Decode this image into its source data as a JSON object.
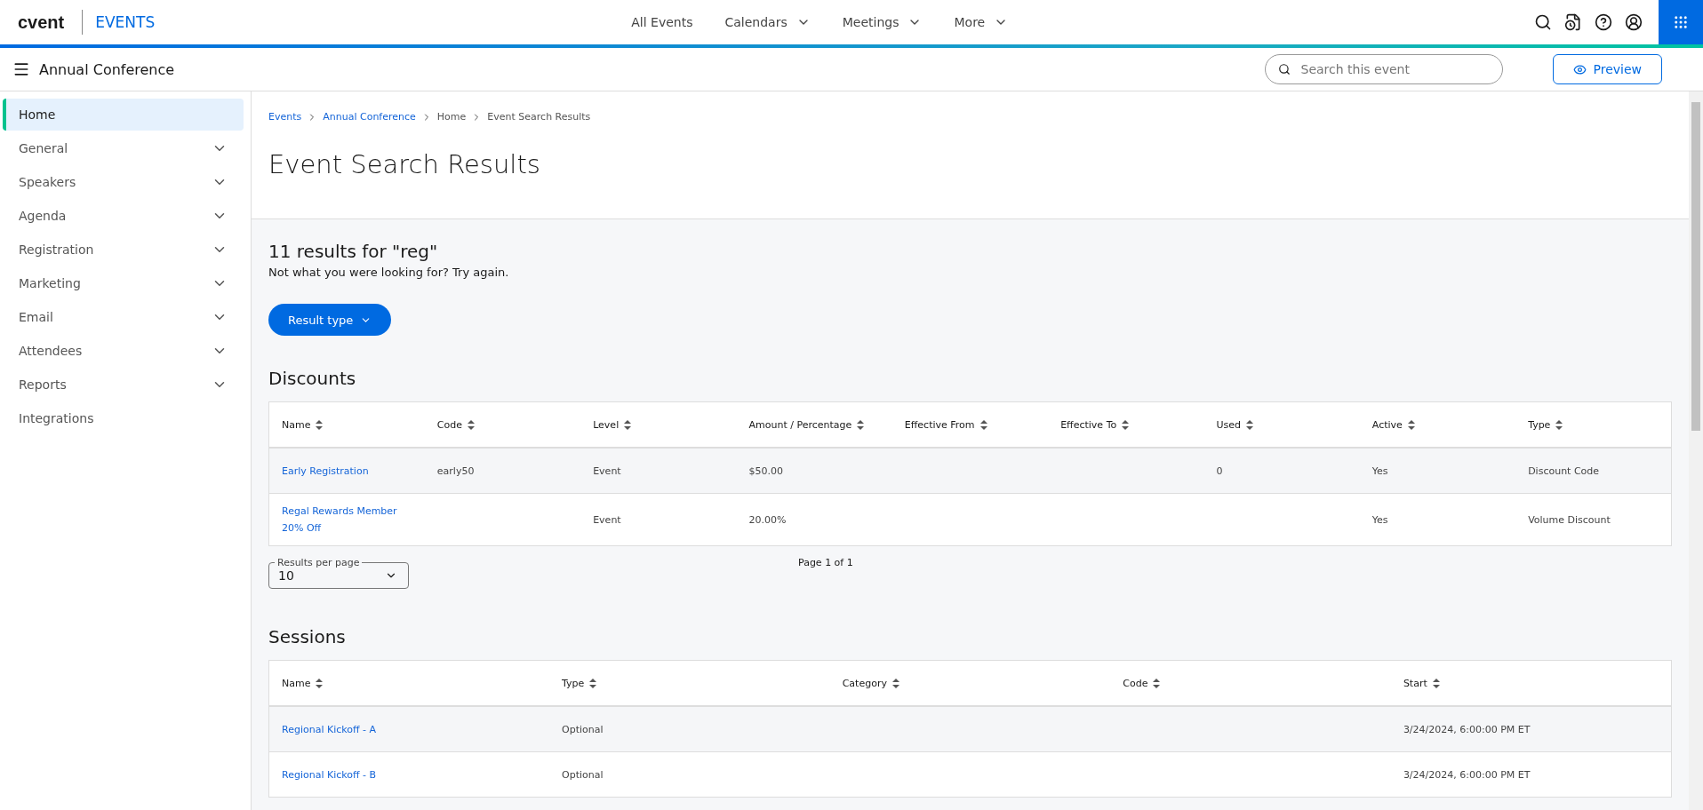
{
  "top_bar": {
    "logo": "cvent",
    "product": "EVENTS",
    "nav": [
      {
        "label": "All Events",
        "kind": "link"
      },
      {
        "label": "Calendars",
        "kind": "menu"
      },
      {
        "label": "Meetings",
        "kind": "menu"
      },
      {
        "label": "More",
        "kind": "menu"
      }
    ]
  },
  "event_bar": {
    "title": "Annual Conference",
    "search": {
      "placeholder": "Search this event"
    },
    "preview_button": "Preview"
  },
  "sidebar": {
    "items": [
      {
        "label": "Home",
        "kind": "link",
        "selected": true
      },
      {
        "label": "General",
        "kind": "group",
        "selected": false
      },
      {
        "label": "Speakers",
        "kind": "group",
        "selected": false
      },
      {
        "label": "Agenda",
        "kind": "group",
        "selected": false
      },
      {
        "label": "Registration",
        "kind": "group",
        "selected": false
      },
      {
        "label": "Marketing",
        "kind": "group",
        "selected": false
      },
      {
        "label": "Email",
        "kind": "group",
        "selected": false
      },
      {
        "label": "Attendees",
        "kind": "group",
        "selected": false
      },
      {
        "label": "Reports",
        "kind": "group",
        "selected": false
      },
      {
        "label": "Integrations",
        "kind": "link",
        "selected": false
      }
    ]
  },
  "breadcrumb": [
    {
      "label": "Events",
      "kind": "link"
    },
    {
      "label": "Annual Conference",
      "kind": "link"
    },
    {
      "label": "Home",
      "kind": "text"
    },
    {
      "label": "Event Search Results",
      "kind": "text"
    }
  ],
  "page_title": "Event Search Results",
  "results_heading": "11 results for \"reg\"",
  "results_hint": "Not what you were looking for? Try again.",
  "filter_button": "Result type",
  "sections": [
    {
      "title": "Discounts",
      "columns": [
        {
          "label": "Name"
        },
        {
          "label": "Code"
        },
        {
          "label": "Level"
        },
        {
          "label": "Amount / Percentage"
        },
        {
          "label": "Effective From"
        },
        {
          "label": "Effective To"
        },
        {
          "label": "Used"
        },
        {
          "label": "Active"
        },
        {
          "label": "Type"
        }
      ],
      "rows": [
        [
          "Early Registration",
          "early50",
          "Event",
          "$50.00",
          "",
          "",
          "0",
          "Yes",
          "Discount Code"
        ],
        [
          "Regal Rewards Member 20% Off",
          "",
          "Event",
          "20.00%",
          "",
          "",
          "",
          "Yes",
          "Volume Discount"
        ]
      ],
      "pager": {
        "label": "Results per page",
        "value": "10",
        "page": "Page 1 of 1"
      }
    },
    {
      "title": "Sessions",
      "columns": [
        {
          "label": "Name"
        },
        {
          "label": "Type"
        },
        {
          "label": "Category"
        },
        {
          "label": "Code"
        },
        {
          "label": "Start"
        }
      ],
      "rows": [
        [
          "Regional Kickoff - A",
          "Optional",
          "",
          "",
          "3/24/2024, 6:00:00 PM ET"
        ],
        [
          "Regional Kickoff - B",
          "Optional",
          "",
          "",
          "3/24/2024, 6:00:00 PM ET"
        ]
      ]
    }
  ]
}
